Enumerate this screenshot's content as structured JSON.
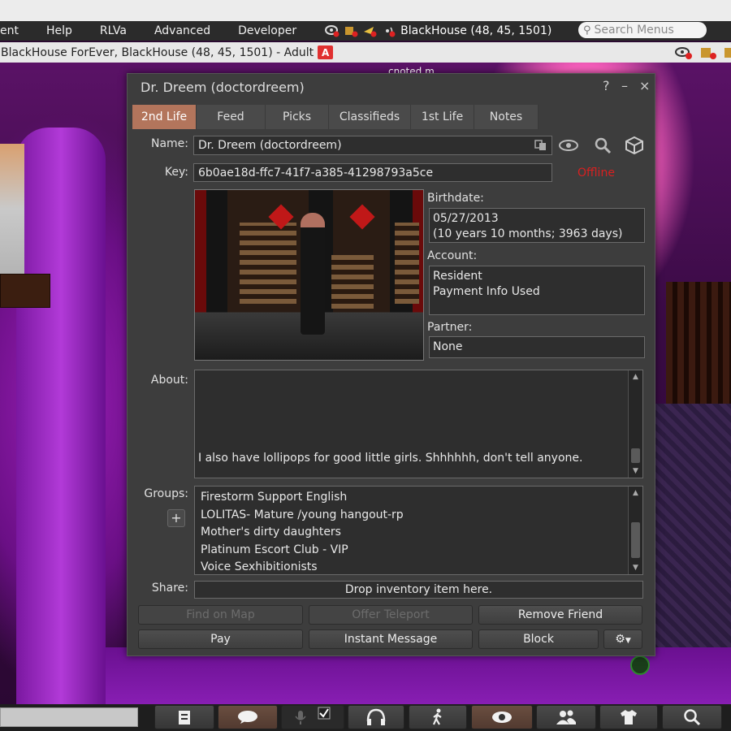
{
  "menubar": {
    "items": [
      "ent",
      "Help",
      "RLVa",
      "Advanced",
      "Developer"
    ],
    "region_status": "BlackHouse (48, 45, 1501)",
    "search_placeholder": "Search Menus"
  },
  "location_bar": {
    "text": "BlackHouse ForEver, BlackHouse (48, 45, 1501) - Adult",
    "maturity_badge": "A"
  },
  "scene": {
    "floating_text": "cnoted m"
  },
  "profile": {
    "title": "Dr. Dreem (doctordreem)",
    "title_buttons": {
      "help": "?",
      "minimize": "–",
      "close": "×"
    },
    "tabs": [
      {
        "label": "2nd Life",
        "active": true
      },
      {
        "label": "Feed",
        "active": false
      },
      {
        "label": "Picks",
        "active": false
      },
      {
        "label": "Classifieds",
        "active": false
      },
      {
        "label": "1st Life",
        "active": false
      },
      {
        "label": "Notes",
        "active": false
      }
    ],
    "name_label": "Name:",
    "name_value": "Dr. Dreem (doctordreem)",
    "key_label": "Key:",
    "key_value": "6b0ae18d-ffc7-41f7-a385-41298793a5ce",
    "status": "Offline",
    "birthdate_label": "Birthdate:",
    "birthdate_line1": "05/27/2013",
    "birthdate_line2": "(10 years 10 months; 3963 days)",
    "account_label": "Account:",
    "account_line1": "Resident",
    "account_line2": "Payment Info Used",
    "partner_label": "Partner:",
    "partner_value": "None",
    "about_label": "About:",
    "about_text": "I also have lollipops for good little girls.  Shhhhhh, don't tell anyone.",
    "groups_label": "Groups:",
    "add_group": "+",
    "groups": [
      "Firestorm Support English",
      "LOLITAS- Mature /young hangout-rp",
      "Mother's dirty daughters",
      "Platinum Escort Club - VIP",
      "Voice Sexhibitionists"
    ],
    "share_label": "Share:",
    "share_drop": "Drop inventory item here.",
    "buttons": {
      "find_on_map": "Find on Map",
      "offer_teleport": "Offer Teleport",
      "remove_friend": "Remove Friend",
      "pay": "Pay",
      "instant_message": "Instant Message",
      "block": "Block"
    }
  },
  "colors": {
    "accent_tab": "#b3755c",
    "offline": "#d82020",
    "panel_bg": "#3d3d3d"
  }
}
